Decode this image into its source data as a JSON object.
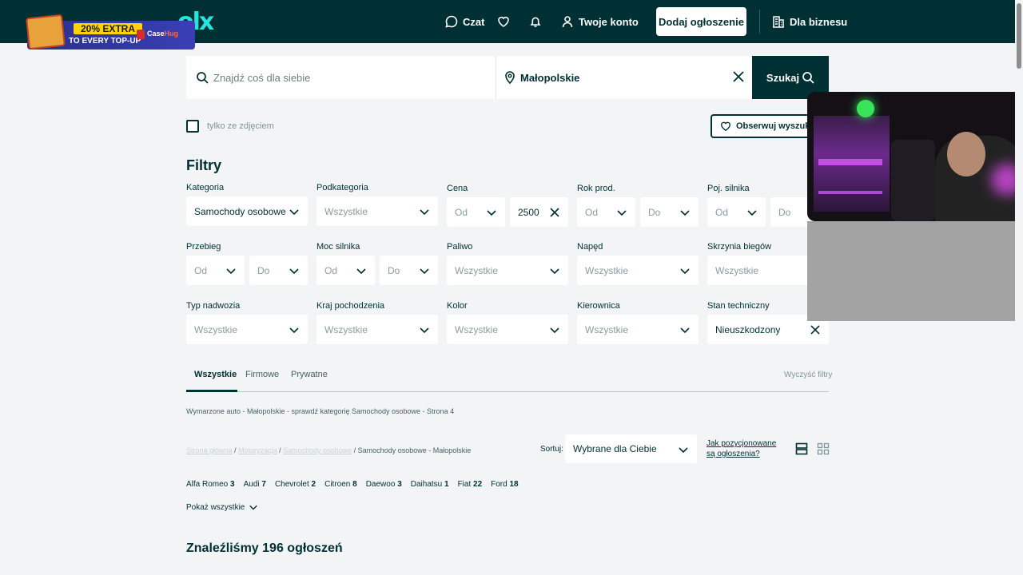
{
  "header": {
    "logo": "olx",
    "promo": {
      "headline": "20% EXTRA",
      "sub": "TO EVERY TOP-UP",
      "brand_a": "Case",
      "brand_b": "Hug"
    },
    "chat": "Czat",
    "account": "Twoje konto",
    "add_listing": "Dodaj ogłoszenie",
    "business": "Dla biznesu"
  },
  "search": {
    "placeholder": "Znajdź coś dla siebie",
    "location": "Małopolskie",
    "button": "Szukaj"
  },
  "photo_only_label": "tylko ze zdjęciem",
  "follow_button": "Obserwuj wyszukiwanie",
  "filters": {
    "title": "Filtry",
    "kategoria": {
      "label": "Kategoria",
      "value": "Samochody osobowe"
    },
    "podkategoria": {
      "label": "Podkategoria",
      "value": "Wszystkie"
    },
    "cena": {
      "label": "Cena",
      "from": "Od",
      "to": "2500"
    },
    "rok": {
      "label": "Rok prod.",
      "from": "Od",
      "to": "Do"
    },
    "poj": {
      "label": "Poj. silnika",
      "from": "Od",
      "to": "Do"
    },
    "przebieg": {
      "label": "Przebieg",
      "from": "Od",
      "to": "Do"
    },
    "moc": {
      "label": "Moc silnika",
      "from": "Od",
      "to": "Do"
    },
    "paliwo": {
      "label": "Paliwo",
      "value": "Wszystkie"
    },
    "naped": {
      "label": "Napęd",
      "value": "Wszystkie"
    },
    "skrzynia": {
      "label": "Skrzynia biegów",
      "value": "Wszystkie"
    },
    "nadwozie": {
      "label": "Typ nadwozia",
      "value": "Wszystkie"
    },
    "kraj": {
      "label": "Kraj pochodzenia",
      "value": "Wszystkie"
    },
    "kolor": {
      "label": "Kolor",
      "value": "Wszystkie"
    },
    "kierownica": {
      "label": "Kierownica",
      "value": "Wszystkie"
    },
    "stan": {
      "label": "Stan techniczny",
      "value": "Nieuszkodzony"
    }
  },
  "tabs": [
    "Wszystkie",
    "Firmowe",
    "Prywatne"
  ],
  "clear_filters": "Wyczyść filtry",
  "seo_text": "Wymarzone auto - Małopolskie - sprawdź kategorię Samochody osobowe - Strona 4",
  "breadcrumbs": {
    "home": "Strona główna",
    "region": "Motoryzacja",
    "category": "Samochody osobowe",
    "current": "Samochody osobowe - Małopolskie"
  },
  "sort": {
    "label": "Sortuj:",
    "value": "Wybrane dla Ciebie",
    "help": "Jak pozycjonowane są ogłoszenia?"
  },
  "brands": [
    {
      "name": "Alfa Romeo",
      "count": "3"
    },
    {
      "name": "Audi",
      "count": "7"
    },
    {
      "name": "Chevrolet",
      "count": "2"
    },
    {
      "name": "Citroen",
      "count": "8"
    },
    {
      "name": "Daewoo",
      "count": "3"
    },
    {
      "name": "Daihatsu",
      "count": "1"
    },
    {
      "name": "Fiat",
      "count": "22"
    },
    {
      "name": "Ford",
      "count": "18"
    }
  ],
  "show_all": "Pokaż wszystkie",
  "results_heading": "Znaleźliśmy 196 ogłoszeń",
  "colors": {
    "brand": "#002f34",
    "accent": "#23e5db",
    "page": "#f2f4f5"
  }
}
